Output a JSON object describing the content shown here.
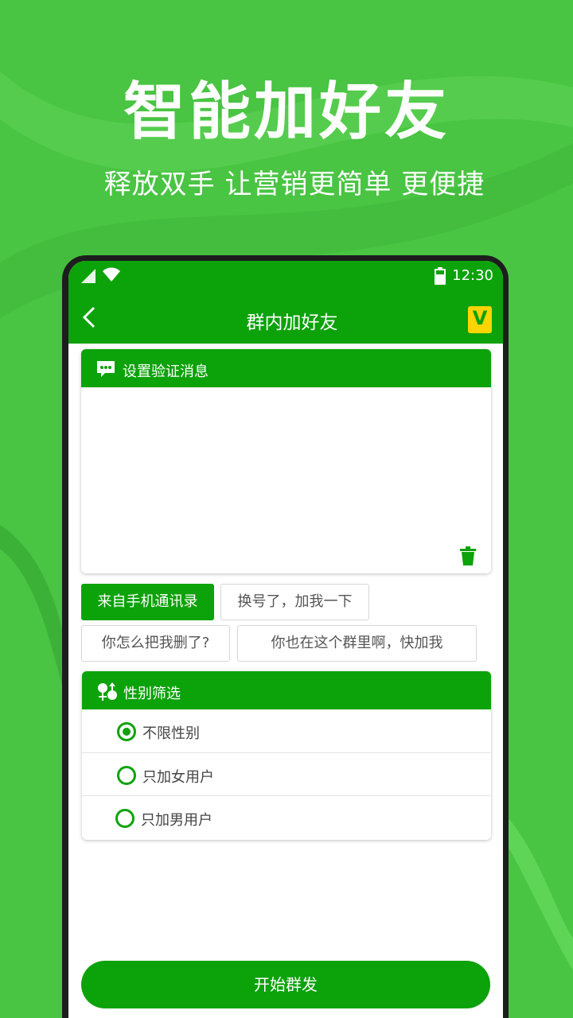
{
  "hero": {
    "title": "智能加好友",
    "subtitle": "释放双手 让营销更简单 更便捷"
  },
  "status_bar": {
    "time": "12:30",
    "icons": [
      "signal-icon",
      "wifi-icon",
      "battery-icon"
    ]
  },
  "app_bar": {
    "title": "群内加好友",
    "back_icon": "back-arrow-icon",
    "badge_letter": "V"
  },
  "verify_card": {
    "header": "设置验证消息",
    "header_icon": "chat-bubble-icon",
    "message_value": "",
    "delete_icon": "trash-icon"
  },
  "quick_phrases": [
    {
      "label": "来自手机通讯录",
      "selected": true
    },
    {
      "label": "换号了，加我一下",
      "selected": false
    },
    {
      "label": "你怎么把我删了?",
      "selected": false
    },
    {
      "label": "你也在这个群里啊，快加我",
      "selected": false
    }
  ],
  "gender_card": {
    "header": "性别筛选",
    "header_icon": "gender-filter-icon",
    "options": [
      {
        "label": "不限性别",
        "checked": true
      },
      {
        "label": "只加女用户",
        "checked": false
      },
      {
        "label": "只加男用户",
        "checked": false
      }
    ]
  },
  "start_button": {
    "label": "开始群发"
  },
  "colors": {
    "background": "#49c443",
    "primary": "#0ca20a",
    "badge": "#ffd400",
    "phone_frame": "#1d1d1d"
  }
}
